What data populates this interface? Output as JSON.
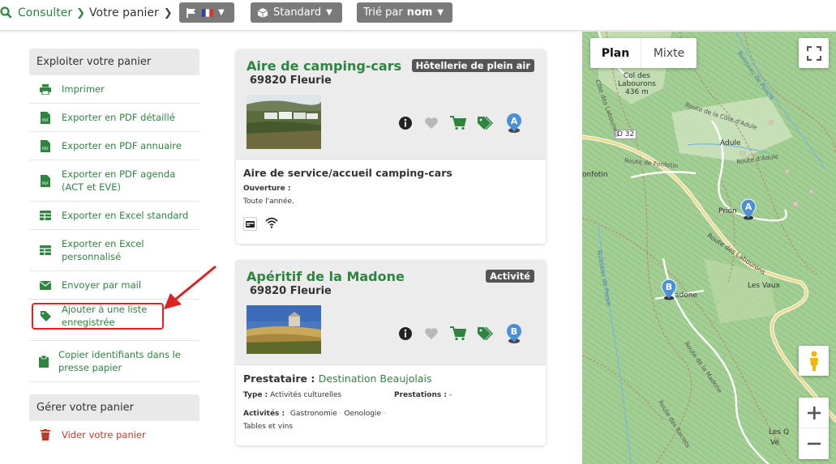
{
  "breadcrumb": {
    "consult": "Consulter",
    "current": "Votre panier"
  },
  "toolbar": {
    "standard_label": "Standard",
    "sort_prefix": "Trié par",
    "sort_value": "nom"
  },
  "sidebar": {
    "export_title": "Exploiter votre panier",
    "items": [
      {
        "label": "Imprimer",
        "icon": "printer-icon"
      },
      {
        "label": "Exporter en PDF détaillé",
        "icon": "pdf-file-icon"
      },
      {
        "label": "Exporter en PDF annuaire",
        "icon": "pdf-file-icon"
      },
      {
        "label": "Exporter en PDF agenda (ACT et EVE)",
        "icon": "pdf-file-icon"
      },
      {
        "label": "Exporter en Excel standard",
        "icon": "table-icon"
      },
      {
        "label": "Exporter en Excel personnalisé",
        "icon": "table-icon"
      },
      {
        "label": "Envoyer par mail",
        "icon": "envelope-icon"
      },
      {
        "label": "Ajouter à une liste enregistrée",
        "icon": "tag-icon"
      },
      {
        "label": "Copier identifiants dans le presse papier",
        "icon": "clipboard-icon"
      }
    ],
    "manage_title": "Gérer votre panier",
    "empty_label": "Vider votre panier"
  },
  "cards": [
    {
      "title": "Aire de camping-cars",
      "badge": "Hôtellerie de plein air",
      "city": "69820 Fleurie",
      "marker": "A",
      "body_title": "Aire de service/accueil camping-cars",
      "opening_label": "Ouverture :",
      "opening_value": "Toute l'année."
    },
    {
      "title": "Apéritif de la Madone",
      "badge": "Activité",
      "city": "69820 Fleurie",
      "marker": "B",
      "provider_label": "Prestataire :",
      "provider_value": "Destination Beaujolais",
      "type_label": "Type :",
      "type_value": "Activités culturelles",
      "prestations_label": "Prestations :",
      "prestations_value": "-",
      "activities_label": "Activités :",
      "activities": [
        "Gastronomie",
        "Oenologie",
        "Tables et vins"
      ]
    }
  ],
  "map": {
    "plan_label": "Plan",
    "mixte_label": "Mixte",
    "labels": {
      "col": "Col des",
      "labourons": "Labourons",
      "alt": "436 m",
      "d32": "D 32",
      "adule": "Adule",
      "fonfotin": "onfotin",
      "route_fonfotin": "Route de Fonfotin",
      "route_adule": "Route d'Adule",
      "route_cote": "Route de la Côte d'Adule",
      "prion": "Prion",
      "route_labourons": "Route des Labourons",
      "ruisseau_poncie": "Ruisseau de Poncié",
      "ruisseau_presle": "Ruisseau de Presle",
      "madone": "adone",
      "vaux": "Les Vaux",
      "route_madone": "Route de la Madone",
      "route_raclets": "Route des Raclets",
      "les_q": "Les Q",
      "ver": "Vé",
      "cote_labourons": "Côte des Labourons"
    }
  },
  "colors": {
    "green": "#2e8540",
    "red_highlight": "#e02020",
    "badge": "#555555"
  }
}
